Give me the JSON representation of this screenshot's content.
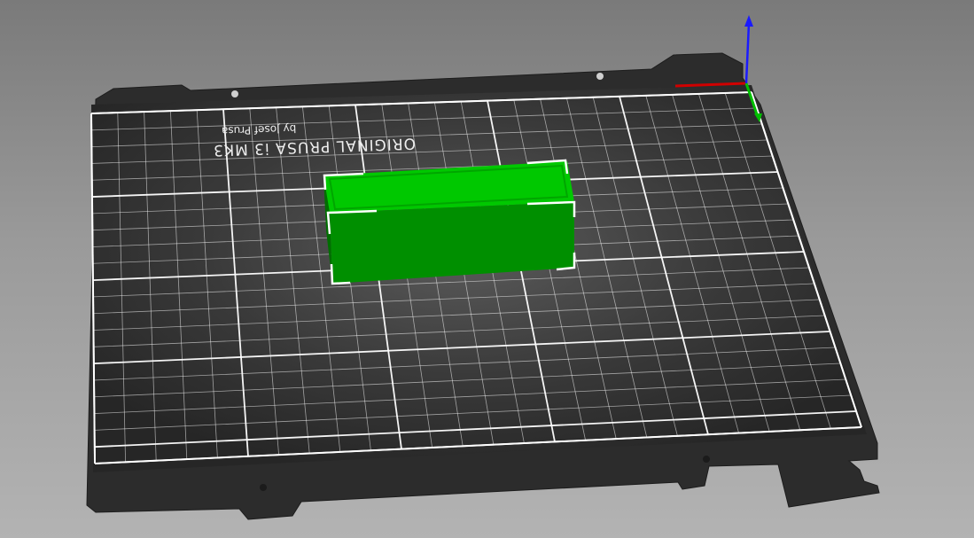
{
  "viewport": {
    "background_top": "#7a7a7a",
    "background_bottom": "#b3b3b3"
  },
  "bed": {
    "title": "ORIGINAL PRUSA i3 MK3",
    "subtitle": "by Josef Prusa",
    "plate_color": "#2e2e2e",
    "grid_color": "#ffffff",
    "grid_columns": 25,
    "grid_rows": 21
  },
  "object": {
    "name": "box",
    "top_color": "#00c800",
    "side_color": "#008f00",
    "selected": true
  },
  "axes": {
    "x_color": "#d00000",
    "y_color": "#00c000",
    "z_color": "#1a1aff",
    "icon": "axes-gizmo-icon"
  }
}
